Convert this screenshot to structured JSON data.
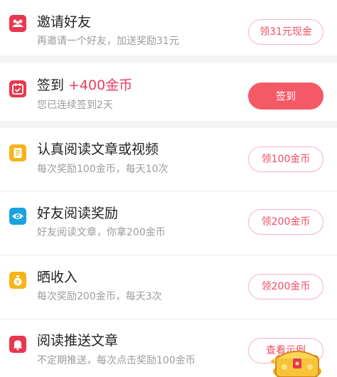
{
  "tasks": [
    {
      "title": "邀请好友",
      "subtitle": "再邀请一个好友，加送奖励31元",
      "button": "领31元现金",
      "icon": "invite-users-icon",
      "icon_color": "#e8374f"
    },
    {
      "title": "签到",
      "title_highlight": "+400金币",
      "subtitle": "您已连续签到2天",
      "button": "签到",
      "icon": "calendar-check-icon",
      "icon_color": "#e8374f"
    },
    {
      "title": "认真阅读文章或视频",
      "subtitle": "每次奖励100金币，每天10次",
      "button": "领100金币",
      "icon": "document-icon",
      "icon_color": "#f6b41b"
    },
    {
      "title": "好友阅读奖励",
      "subtitle": "好友阅读文章，你拿200金币",
      "button": "领200金币",
      "icon": "eye-icon",
      "icon_color": "#1aa3de"
    },
    {
      "title": "晒收入",
      "subtitle": "每次奖励200金币，每天3次",
      "button": "领200金币",
      "icon": "money-bag-icon",
      "icon_color": "#f6b41b"
    },
    {
      "title": "阅读推送文章",
      "subtitle": "不定期推送，每次点击奖励100金币",
      "button": "查看示例",
      "icon": "bell-icon",
      "icon_color": "#e8374f"
    }
  ],
  "colors": {
    "accent": "#ee3b5f",
    "primary_button": "#f45a66",
    "button_border": "#f3b6c0",
    "subtitle_text": "#9c9c9c"
  }
}
